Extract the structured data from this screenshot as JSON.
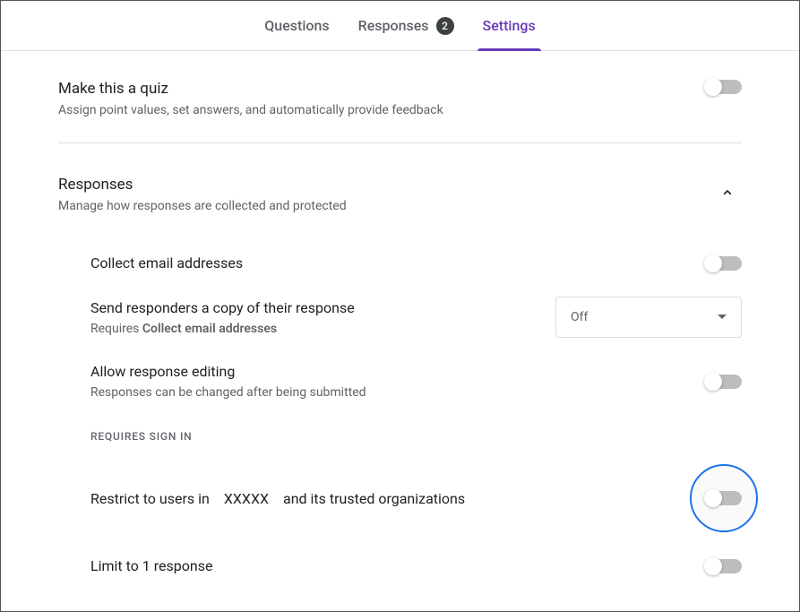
{
  "tabs": {
    "questions": "Questions",
    "responses": "Responses",
    "responses_count": "2",
    "settings": "Settings"
  },
  "quiz": {
    "title": "Make this a quiz",
    "subtitle": "Assign point values, set answers, and automatically provide feedback"
  },
  "responses": {
    "title": "Responses",
    "subtitle": "Manage how responses are collected and protected",
    "collect_email": "Collect email addresses",
    "send_copy": {
      "title": "Send responders a copy of their response",
      "requires_prefix": "Requires ",
      "requires_bold": "Collect email addresses",
      "dropdown_value": "Off"
    },
    "allow_editing": {
      "title": "Allow response editing",
      "subtitle": "Responses can be changed after being submitted"
    },
    "requires_sign_in_label": "REQUIRES SIGN IN",
    "restrict": {
      "part1": "Restrict to users in",
      "org": "XXXXX",
      "part2": "and its trusted organizations"
    },
    "limit_one": "Limit to 1 response"
  }
}
